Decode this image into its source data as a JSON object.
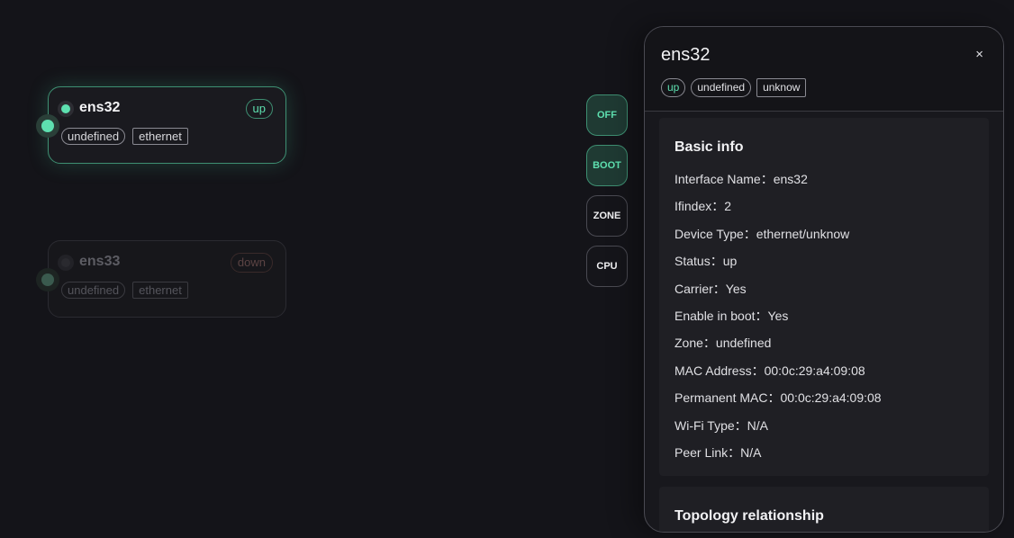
{
  "nodes": [
    {
      "name": "ens32",
      "status": "up",
      "tags": [
        "undefined",
        "ethernet"
      ]
    },
    {
      "name": "ens33",
      "status": "down",
      "tags": [
        "undefined",
        "ethernet"
      ]
    }
  ],
  "toggles": [
    {
      "label": "OFF",
      "state": "on"
    },
    {
      "label": "BOOT",
      "state": "on"
    },
    {
      "label": "ZONE",
      "state": "off"
    },
    {
      "label": "CPU",
      "state": "off"
    }
  ],
  "panel": {
    "title": "ens32",
    "close": "×",
    "tags": [
      "up",
      "undefined",
      "unknow"
    ],
    "basic_info": {
      "title": "Basic info",
      "rows": [
        "Interface Name：ens32",
        "Ifindex：2",
        "Device Type：ethernet/unknow",
        "Status：up",
        "Carrier：Yes",
        "Enable in boot：Yes",
        "Zone：undefined",
        "MAC Address：00:0c:29:a4:09:08",
        "Permanent MAC：00:0c:29:a4:09:08",
        "Wi-Fi Type：N/A",
        "Peer Link：N/A"
      ]
    },
    "topology": {
      "title": "Topology relationship"
    }
  },
  "colors": {
    "accent": "#5ee0b0",
    "background": "#141419",
    "panel": "#18181d"
  }
}
